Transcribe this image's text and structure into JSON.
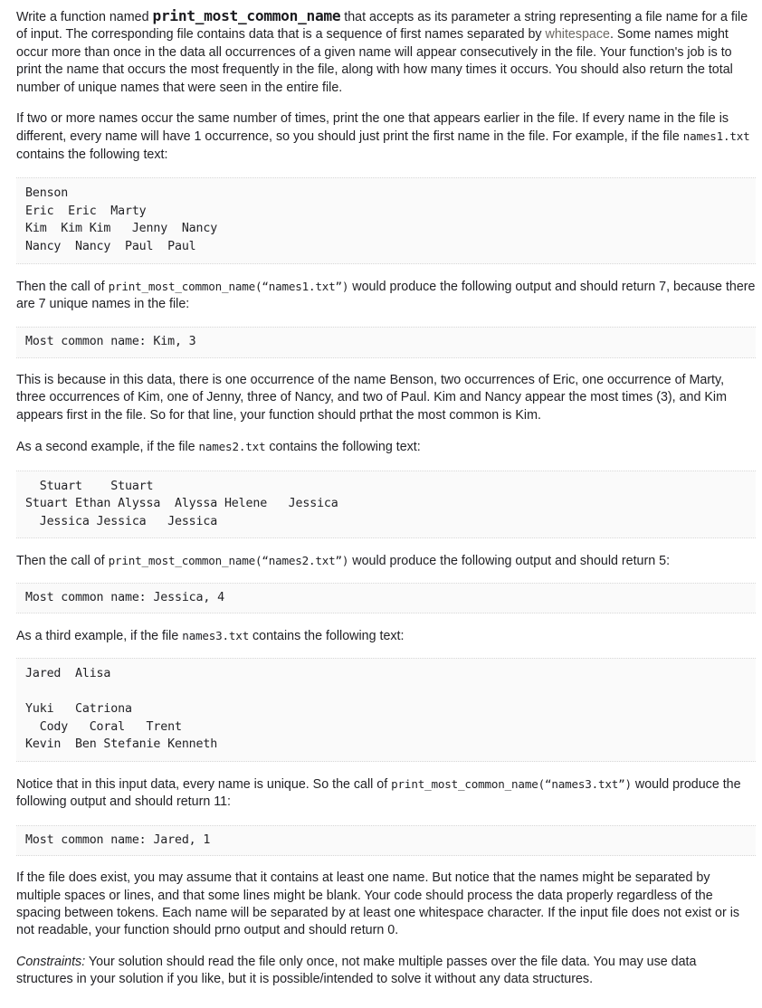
{
  "document": {
    "function_name": "print_most_common_name",
    "paragraphs": {
      "intro_1": "Write a function named ",
      "intro_2": " that accepts as its parameter a string representing a file name for a file of input. The corresponding file contains data that is a sequence of first names separated by ",
      "intro_highlight": "whitespace",
      "intro_3": ". Some names might occur more than once in the data all occurrences of a given name will appear consecutively in the file. Your function's job is to print the name that occurs the most frequently in the file, along with how many times it occurs. You should also return the total number of unique names that were seen in the entire file.",
      "tie_rule_1": "If two or more names occur the same number of times, print the one that appears earlier in the file. If every name in the file is different, every name will have 1 occurrence, so you should just print the first name in the file. For example, if the file ",
      "tie_rule_file": "names1.txt",
      "tie_rule_2": " contains the following text:",
      "call1_1": "Then the call of ",
      "call1_code": "print_most_common_name(“names1.txt”)",
      "call1_2": " would produce the following output and should return 7, because there are 7 unique names in the file:",
      "explain": "This is because in this data, there is one occurrence of the name Benson, two occurrences of Eric, one occurrence of Marty, three occurrences of Kim, one of Jenny, three of Nancy, and two of Paul. Kim and Nancy appear the most times (3), and Kim appears first in the file. So for that line, your function should prthat the most common is Kim.",
      "second_example_1": "As a second example, if the file ",
      "second_example_file": "names2.txt",
      "second_example_2": " contains the following text:",
      "call2_1": "Then the call of ",
      "call2_code": "print_most_common_name(“names2.txt”)",
      "call2_2": " would produce the following output and should return 5:",
      "third_example_1": "As a third example, if the file ",
      "third_example_file": "names3.txt",
      "third_example_2": " contains the following text:",
      "call3_1": "Notice that in this input data, every name is unique. So the call of ",
      "call3_code": "print_most_common_name(“names3.txt”)",
      "call3_2": " would produce the following output and should return 11:",
      "notes": "If the file does exist, you may assume that it contains at least one name. But notice that the names might be separated by multiple spaces or lines, and that some lines might be blank. Your code should process the data properly regardless of the spacing between tokens. Each name will be separated by at least one whitespace character. If the input file does not exist or is not readable, your function should prno output and should return 0.",
      "constraints_label": "Constraints:",
      "constraints_text": " Your solution should read the file only once, not make multiple passes over the file data. You may use data structures in your solution if you like, but it is possible/intended to solve it without any data structures."
    },
    "code_blocks": {
      "names1_input": "Benson\nEric  Eric  Marty\nKim  Kim Kim   Jenny  Nancy\nNancy  Nancy  Paul  Paul",
      "names1_output": "Most common name: Kim, 3",
      "names2_input": "  Stuart    Stuart\nStuart Ethan Alyssa  Alyssa Helene   Jessica\n  Jessica Jessica   Jessica",
      "names2_output": "Most common name: Jessica, 4",
      "names3_input": "Jared  Alisa\n\nYuki   Catriona\n  Cody   Coral   Trent\nKevin  Ben Stefanie Kenneth",
      "names3_output": "Most common name: Jared, 1"
    },
    "colors": {
      "text": "#222226",
      "code_background": "#fafafa",
      "code_border": "#d8d8d8",
      "highlight_text": "#6d6a63"
    }
  }
}
